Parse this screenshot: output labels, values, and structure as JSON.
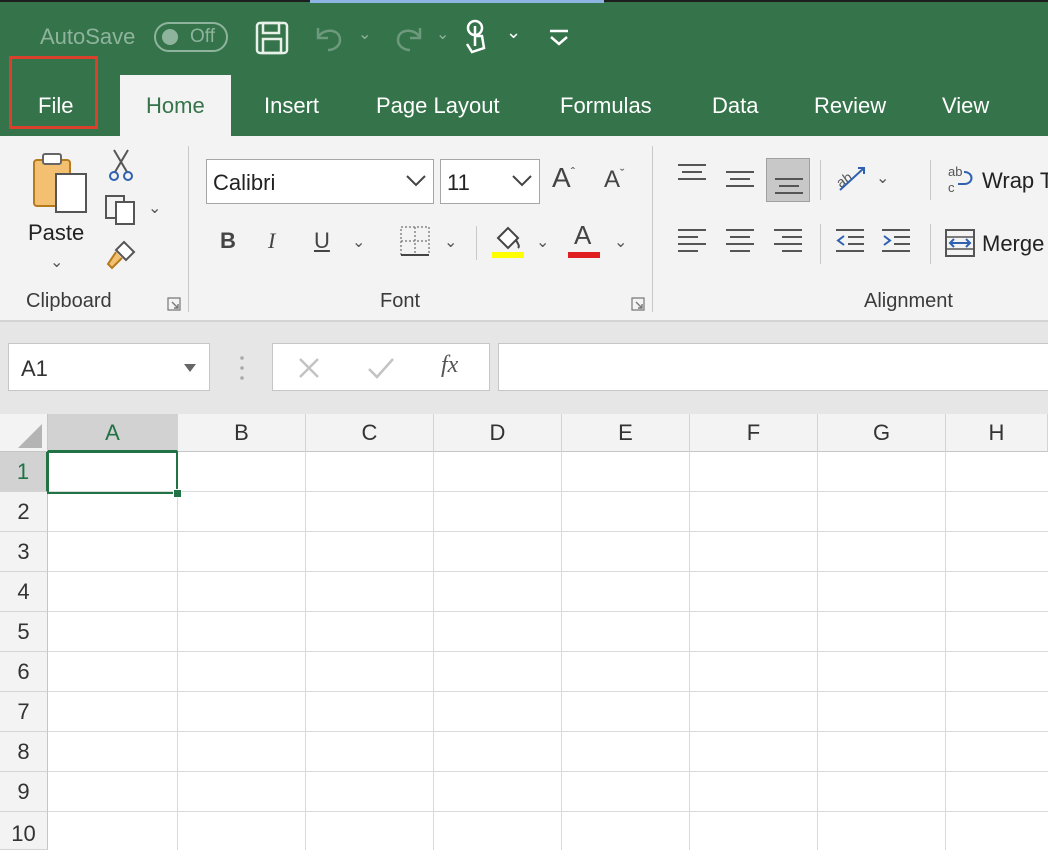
{
  "qat": {
    "autosave_label": "AutoSave",
    "autosave_state": "Off"
  },
  "tabs": [
    {
      "label": "File"
    },
    {
      "label": "Home"
    },
    {
      "label": "Insert"
    },
    {
      "label": "Page Layout"
    },
    {
      "label": "Formulas"
    },
    {
      "label": "Data"
    },
    {
      "label": "Review"
    },
    {
      "label": "View"
    }
  ],
  "ribbon": {
    "clipboard": {
      "paste_label": "Paste",
      "group_label": "Clipboard"
    },
    "font": {
      "font_name": "Calibri",
      "font_size": "11",
      "bold": "B",
      "italic": "I",
      "underline": "U",
      "font_color_glyph": "A",
      "group_label": "Font"
    },
    "alignment": {
      "wrap_label": "Wrap T",
      "merge_label": "Merge",
      "group_label": "Alignment"
    }
  },
  "formula_bar": {
    "name_box": "A1",
    "fx": "fx",
    "formula": ""
  },
  "grid": {
    "columns": [
      "A",
      "B",
      "C",
      "D",
      "E",
      "F",
      "G",
      "H"
    ],
    "rows": [
      "1",
      "2",
      "3",
      "4",
      "5",
      "6",
      "7",
      "8",
      "9",
      "10"
    ],
    "active_cell": "A1"
  },
  "colors": {
    "excel_green": "#35734a",
    "highlight_red": "#d9412d",
    "fill_yellow": "#ffff00",
    "font_red": "#e02020"
  }
}
